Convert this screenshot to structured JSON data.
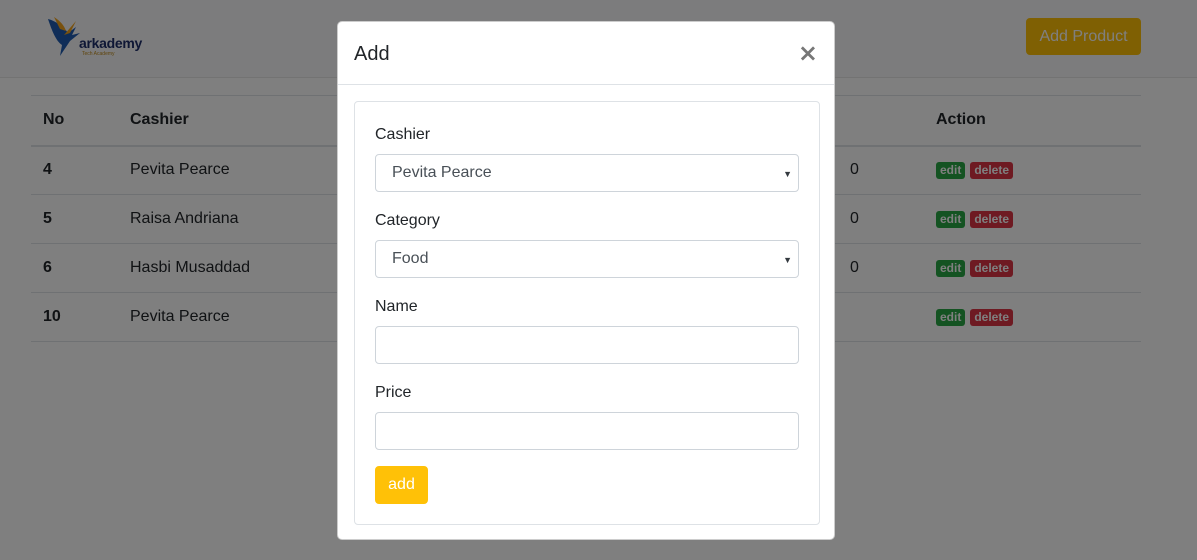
{
  "header": {
    "logo_text": "arkademy",
    "logo_subtext": "Tech Academy",
    "add_product_label": "Add Product"
  },
  "table": {
    "columns": [
      "No",
      "Cashier",
      "Action"
    ],
    "rows": [
      {
        "no": "4",
        "cashier": "Pevita Pearce",
        "partial": "0"
      },
      {
        "no": "5",
        "cashier": "Raisa Andriana",
        "partial": "0"
      },
      {
        "no": "6",
        "cashier": "Hasbi Musaddad",
        "partial": "0"
      },
      {
        "no": "10",
        "cashier": "Pevita Pearce",
        "partial": ""
      }
    ],
    "edit_label": "edit",
    "delete_label": "delete"
  },
  "modal": {
    "title": "Add",
    "close_glyph": "×",
    "cashier_label": "Cashier",
    "cashier_value": "Pevita Pearce",
    "category_label": "Category",
    "category_value": "Food",
    "name_label": "Name",
    "name_value": "",
    "price_label": "Price",
    "price_value": "",
    "submit_label": "add",
    "select_caret": "▼"
  },
  "colors": {
    "accent": "#ffc107",
    "edit": "#28a745",
    "delete": "#dc3545"
  }
}
